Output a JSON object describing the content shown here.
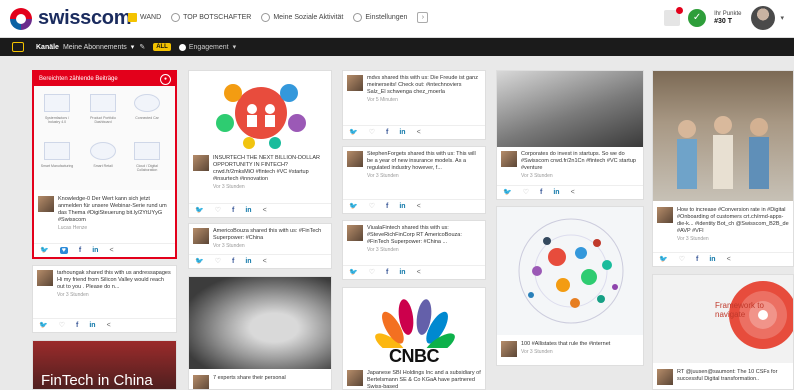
{
  "header": {
    "logo_text": "swisscom",
    "nav": [
      {
        "label": "WAND",
        "active": true
      },
      {
        "label": "TOP BOTSCHAFTER",
        "active": false
      },
      {
        "label": "Meine Soziale Aktivität",
        "active": false
      },
      {
        "label": "Einstellungen",
        "active": false
      }
    ],
    "punkte_label": "Ihr Punkte",
    "punkte_value": "#30 T"
  },
  "subbar": {
    "kanale": "Kanäle",
    "abos": "Meine Abonnements",
    "all_badge": "ALL",
    "engagement": "Engagement"
  },
  "highlight_card": {
    "title": "Bereichten zählende Beiträge",
    "gallery_captions": [
      "Systemfactors / Industry 4.0",
      "Product Portfolio Dashboard",
      "Connected Car",
      "Smart Manufacturing",
      "Smart Retail",
      "Cloud / Digital Collaboration",
      "Digital Workspace",
      "Smart Robotics"
    ],
    "post_text": "Knowledge-0 Der Wert kann sich jetzt anmelden für unsere Webinar-Serie rund um das Thema #DigiSteuerung bit.ly/2YtUYyG #Swisscom",
    "post_src": "Lucas Henze"
  },
  "columns": {
    "c1_post2": {
      "text": "tarhoungak shared this with us andressapages Hi my friend from Silicon Valley would reach out to you . Please do n...",
      "src": "Vor 3 Stunden"
    },
    "c2_post1": {
      "text": "INSURTECH THE NEXT BILLION-DOLLAR OPPORTUNITY IN FINTECH? crwd.fr/2mksMiO #fintech #VC #startup #insurtech #innovation",
      "src": "Vor 3 Stunden"
    },
    "c2_post2": {
      "text": "AmericoBouza shared this with us: #FinTech Superpower: #China",
      "src": "Vor 3 Stunden"
    },
    "c2_post3": {
      "text": "7 experts share their personal",
      "src": ""
    },
    "c3_post1": {
      "text": "mdvs shared this with us: Die Freude ist ganz meinerseits! Check out: #intechnoviers Salz_El schwenga chez_moerla",
      "src": "Vor 5 Minuten"
    },
    "c3_post2": {
      "text": "StephenForgets shared this with us: This will be a year of new insurance models. As a regulated industry however, f...",
      "src": "Vor 3 Stunden"
    },
    "c3_post3": {
      "text": "ViualaFintech shared this with us: #SteveRichFinCorp RT AmericoBouza: #FinTech Superpower: #China ...",
      "src": "Vor 3 Stunden"
    },
    "c3_post4": {
      "text": "Japanese SBI Holdings Inc and a subsidiary of Bertelsmann SE & Co KGaA have partnered Swiss-based",
      "src": ""
    },
    "c3_cnbc": "CNBC",
    "c4_post1": {
      "text": "Corporates do invest in startups. So we do #Swisscom crwd.fr/2n1Cn #fintech #VC startup #venture",
      "src": "Vor 3 Stunden"
    },
    "c4_post2": {
      "text": "100 #Allistates that rule the #internet",
      "src": "Vor 3 Stunden"
    },
    "c5_post1": {
      "text": "How to increase #Conversion rate in #Digital #Onboarding of customers crt.ch/rmd-apps-die-k... #identity Bot_ch @Swisscom_B2B_de #AVP #VFI",
      "src": "Vor 3 Stunden"
    },
    "c5_post2": {
      "text": "RT @juusen@saumont: The 10 CSFs for successful Digital transformation..",
      "src": ""
    },
    "c5_navigate": "Framework to navigate",
    "c1_fintech": "FinTech in China"
  }
}
